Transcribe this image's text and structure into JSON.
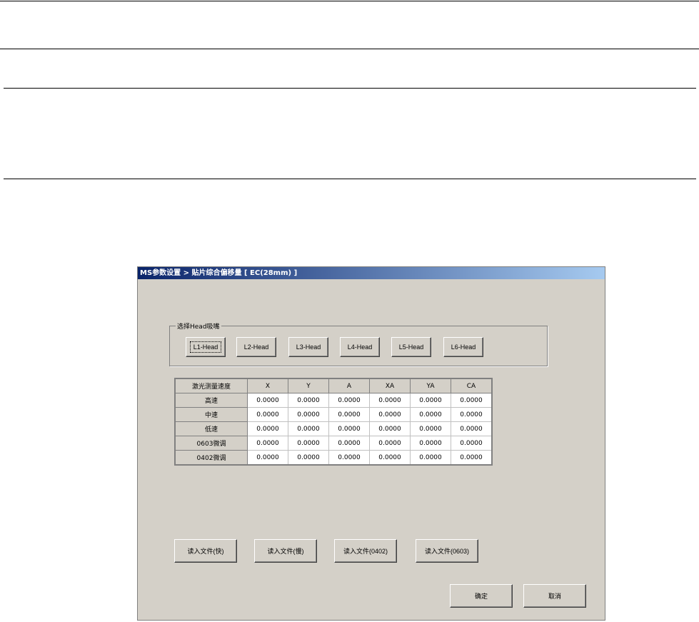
{
  "dialog": {
    "title": "MS参数设置 > 贴片综合偏移量 [ EC(28mm) ]",
    "group_label": "选择Head吸嘴",
    "heads": [
      "L1-Head",
      "L2-Head",
      "L3-Head",
      "L4-Head",
      "L5-Head",
      "L6-Head"
    ],
    "table": {
      "headers": [
        "激光测量速度",
        "X",
        "Y",
        "A",
        "XA",
        "YA",
        "CA"
      ],
      "rows": [
        {
          "label": "高速",
          "values": [
            "0.0000",
            "0.0000",
            "0.0000",
            "0.0000",
            "0.0000",
            "0.0000"
          ]
        },
        {
          "label": "中速",
          "values": [
            "0.0000",
            "0.0000",
            "0.0000",
            "0.0000",
            "0.0000",
            "0.0000"
          ]
        },
        {
          "label": "低速",
          "values": [
            "0.0000",
            "0.0000",
            "0.0000",
            "0.0000",
            "0.0000",
            "0.0000"
          ]
        },
        {
          "label": "0603微调",
          "values": [
            "0.0000",
            "0.0000",
            "0.0000",
            "0.0000",
            "0.0000",
            "0.0000"
          ]
        },
        {
          "label": "0402微调",
          "values": [
            "0.0000",
            "0.0000",
            "0.0000",
            "0.0000",
            "0.0000",
            "0.0000"
          ]
        }
      ]
    },
    "file_buttons": [
      "读入文件(快)",
      "读入文件(慢)",
      "读入文件(0402)",
      "读入文件(0603)"
    ],
    "ok": "确定",
    "cancel": "取消"
  }
}
